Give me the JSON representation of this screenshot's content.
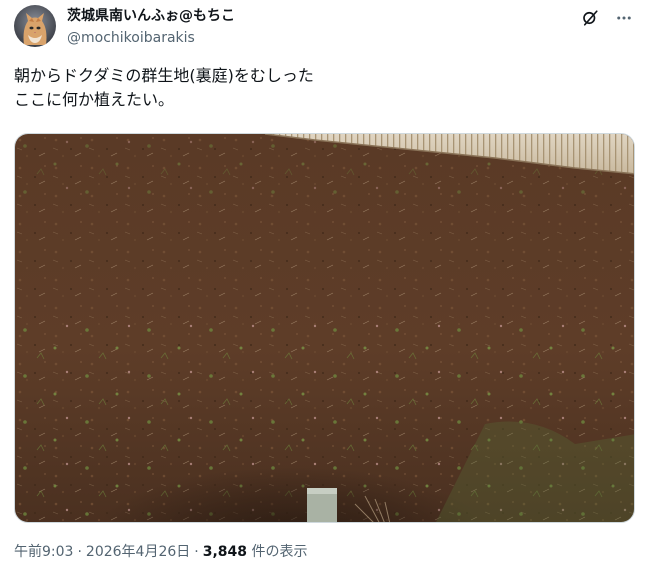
{
  "author": {
    "display_name": "茨城県南いんふぉ@もちこ",
    "handle": "@mochikoibarakis",
    "avatar_icon": "cat-avatar"
  },
  "header_icons": [
    "grok-icon",
    "more-icon"
  ],
  "post": {
    "lines": [
      "朝からドクダミの群生地(裏庭)をむしった",
      "ここに何か植えたい。"
    ]
  },
  "media": {
    "icon": "photo-soil-garden"
  },
  "meta": {
    "time": "午前9:03",
    "separator": "·",
    "date": "2026年4月26日",
    "views_count": "3,848",
    "views_label": "件の表示"
  },
  "colors": {
    "text": "#0f1419",
    "secondary": "#536471",
    "soil": "#5a3a26"
  }
}
